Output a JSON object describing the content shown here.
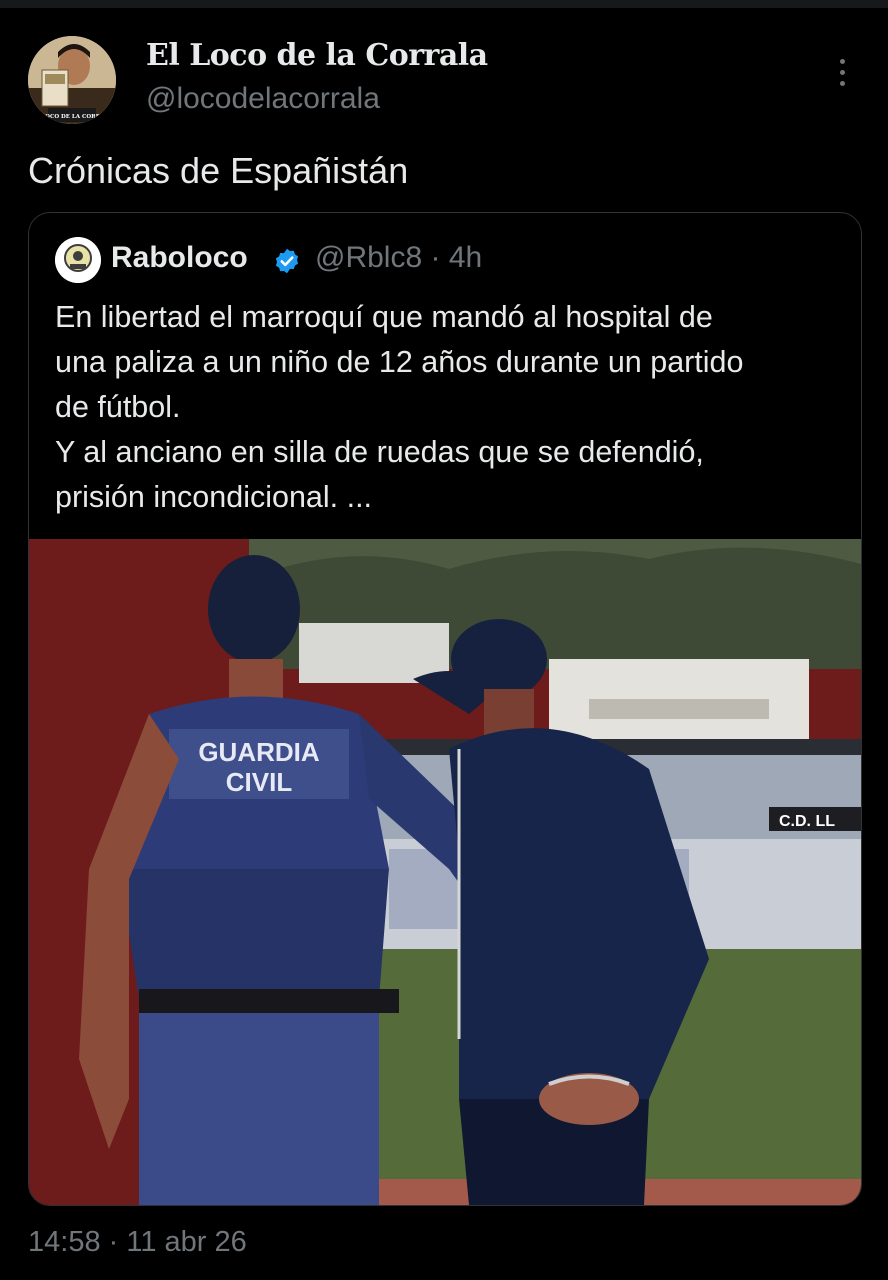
{
  "author": {
    "display_name": "El Loco de la Corrala",
    "handle": "@locodelacorrala",
    "avatar_caption": "EL LOCO DE LA CORRALA"
  },
  "tweet": {
    "text": "Crónicas de Españistán",
    "timestamp": "14:58 · 11 abr 26"
  },
  "quoted": {
    "name": "Raboloco",
    "handle_time": "@Rblc8 · 4h",
    "lines": [
      "En libertad el marroquí que mandó al hospital de",
      "una paliza a un niño de 12 años durante un partido",
      "de fútbol.",
      "Y al anciano en silla de ruedas que se defendió,",
      "prisión incondicional. ..."
    ],
    "image": {
      "vest_line1": "GUARDIA",
      "vest_line2": "CIVIL",
      "banner_text": "C.D. LL"
    }
  },
  "colors": {
    "background": "#000000",
    "text": "#e7e9ea",
    "secondary": "#71767b",
    "border": "#2f3336",
    "verified": "#1d9bf0"
  },
  "icons": {
    "more": "more-dots-icon",
    "verified": "verified-badge-icon"
  }
}
